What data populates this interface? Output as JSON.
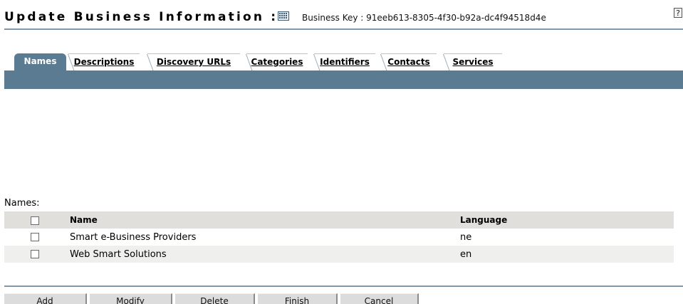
{
  "header": {
    "title": "Update Business Information :",
    "business_key": "Business Key : 91eeb613-8305-4f30-b92a-dc4f94518d4e",
    "help_glyph": "?"
  },
  "tabs": [
    {
      "label": "Names",
      "active": true
    },
    {
      "label": "Descriptions",
      "active": false
    },
    {
      "label": "Discovery URLs",
      "active": false
    },
    {
      "label": "Categories",
      "active": false
    },
    {
      "label": "Identifiers",
      "active": false
    },
    {
      "label": "Contacts",
      "active": false
    },
    {
      "label": "Services",
      "active": false
    }
  ],
  "names": {
    "section_label": "Names:",
    "columns": {
      "name": "Name",
      "language": "Language"
    },
    "rows": [
      {
        "name": "Smart e-Business Providers",
        "language": "ne"
      },
      {
        "name": "Web Smart Solutions",
        "language": "en"
      }
    ]
  },
  "buttons": {
    "add": "Add",
    "modify": "Modify",
    "delete": "Delete",
    "finish": "Finish",
    "cancel": "Cancel"
  },
  "colors": {
    "tab_bar": "#5b7b93",
    "rule": "#7f98ab",
    "header_row": "#e0dfdc",
    "alt_row": "#efefed"
  }
}
